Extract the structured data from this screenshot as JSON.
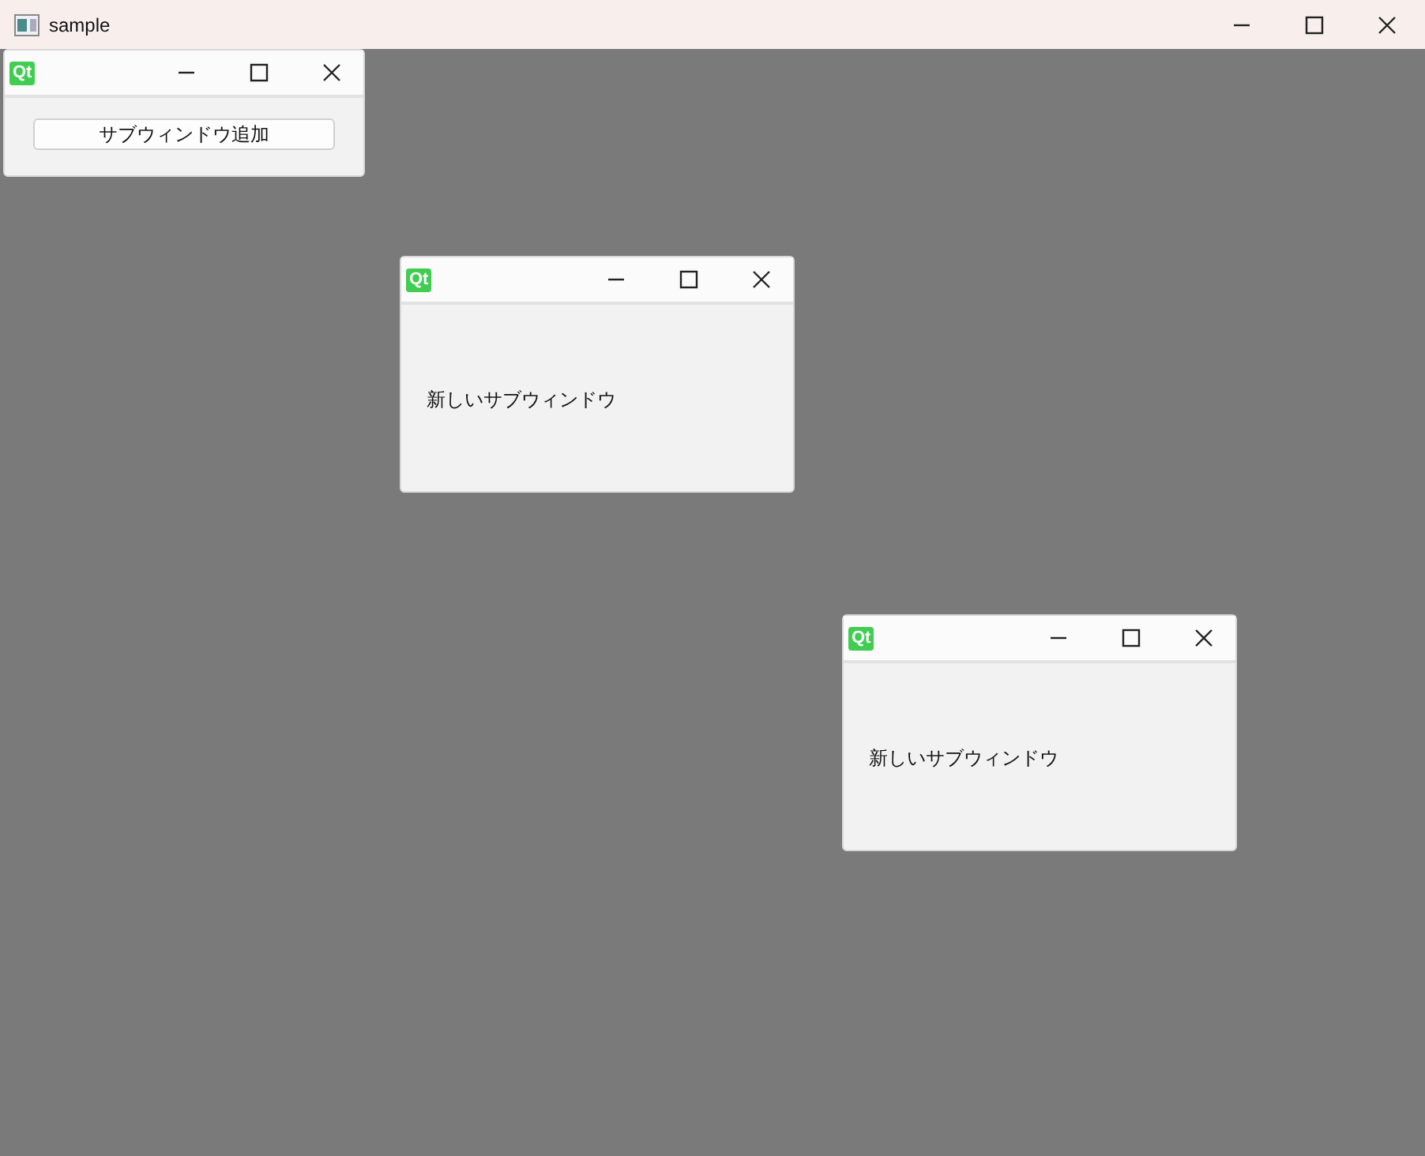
{
  "window": {
    "title": "sample"
  },
  "subwindows": [
    {
      "logo": "Qt",
      "kind": "button",
      "content": "サブウィンドウ追加"
    },
    {
      "logo": "Qt",
      "kind": "label",
      "content": "新しいサブウィンドウ"
    },
    {
      "logo": "Qt",
      "kind": "label",
      "content": "新しいサブウィンドウ"
    }
  ]
}
